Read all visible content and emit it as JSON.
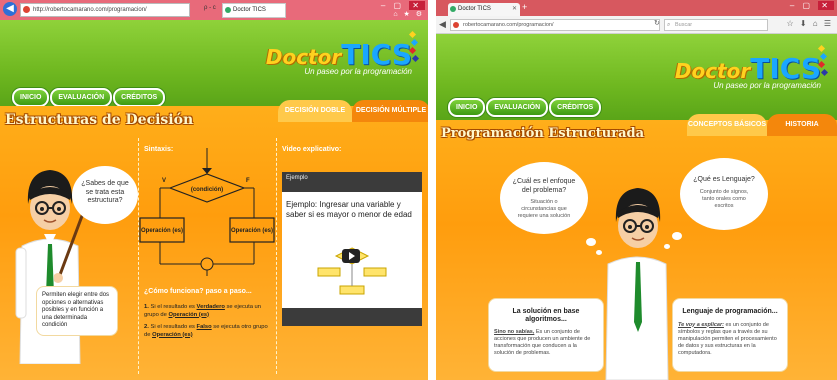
{
  "left": {
    "browser": {
      "url": "http://robertocamarano.com/programacion/",
      "tab_title": "Doctor TICS",
      "search_hint": "ρ - c"
    },
    "site": {
      "logo_word1": "Doctor",
      "logo_word2": "TICS",
      "tagline": "Un paseo por la programación",
      "nav": [
        "INICIO",
        "EVALUACIÓN",
        "CRÉDITOS"
      ]
    },
    "page": {
      "title": "Estructuras de Decisión",
      "tabs": [
        "DECISIÓN DOBLE",
        "DECISIÓN MÚLTIPLE"
      ],
      "question_bubble": "¿Sabes de que se trata esta estructura?",
      "explanation": "Permiten elegir entre dos opciones o alternativas posibles y en función a una determinada condición",
      "sintaxis_label": "Sintaxis:",
      "flow": {
        "condition": "(condición)",
        "true_label": "V",
        "false_label": "F",
        "op_true": "Operación (es)",
        "op_false": "Operación (es)"
      },
      "how_title": "¿Cómo funciona? paso a paso...",
      "steps": [
        {
          "num": "1.",
          "pre": "Si el resultado es ",
          "key": "Verdadero",
          "mid": " se ejecuta un grupo de ",
          "op": "Operación (es)"
        },
        {
          "num": "2.",
          "pre": "Si el resultado es ",
          "key": "Falso",
          "mid": " se ejecuta  otro grupo  de ",
          "op": "Operación (es)"
        }
      ],
      "video_label": "Video explicativo:",
      "video_title": "Ejemplo: Ingresar una variable y saber si es mayor o menor de edad",
      "video_channel": "Ejemplo"
    }
  },
  "right": {
    "browser": {
      "url": "robertocamarano.com/programacion/",
      "tab_title": "Doctor TICS",
      "search_placeholder": "Buscar"
    },
    "site": {
      "logo_word1": "Doctor",
      "logo_word2": "TICS",
      "tagline": "Un paseo por la programación",
      "nav": [
        "INICIO",
        "EVALUACIÓN",
        "CRÉDITOS"
      ]
    },
    "page": {
      "title": "Programación Estructurada",
      "tabs": [
        "CONCEPTOS BÁSICOS",
        "HISTORIA"
      ],
      "bubble1_title": "¿Cuál es el enfoque del problema?",
      "bubble1_body": "Situación o circunstancias que requiere una solución",
      "bubble2_title": "¿Qué es Lenguaje?",
      "bubble2_body": "Conjunto de signos, tanto orales como escritos",
      "box1_title": "La solución en base algoritmos...",
      "box1_lead": "Sino no sabías,",
      "box1_body": " Es un conjunto de  acciones que producen un ambiente de transformación que conducen a la solución de problemas.",
      "box2_title": "Lenguaje de programación...",
      "box2_lead": "Te voy a explicar:",
      "box2_body": " es un conjunto de símbolos y reglas que a través de su manipulación permiten el procesamiento de datos y sus estructuras en la computadora."
    }
  },
  "colors": {
    "green_header": "#6fb820",
    "orange_page": "#ffa214",
    "tab_active": "#ffc94a",
    "tab_inactive": "#f4870c",
    "title_text": "#fff8cc"
  }
}
